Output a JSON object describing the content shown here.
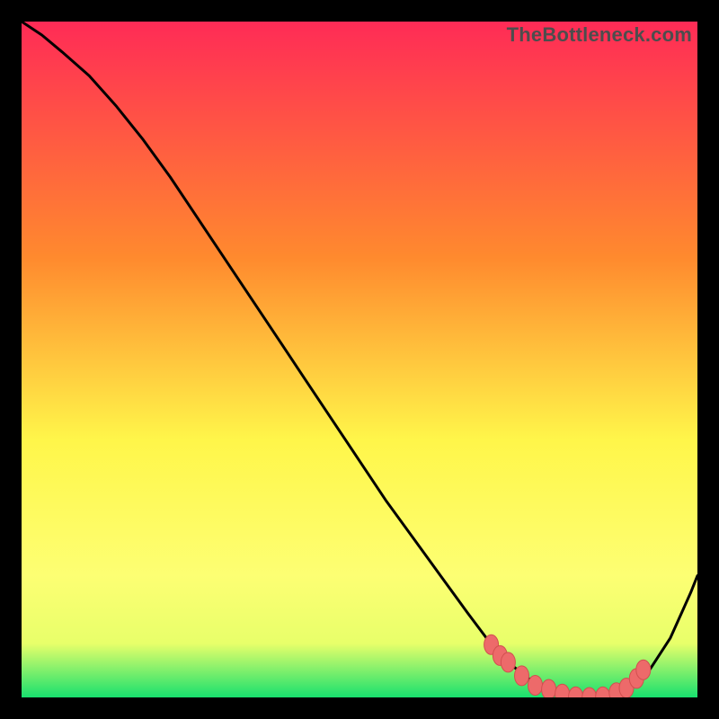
{
  "watermark": "TheBottleneck.com",
  "colors": {
    "frame": "#000000",
    "gradient_top": "#ff2b56",
    "gradient_upper_mid": "#ff8a2e",
    "gradient_mid": "#fff64a",
    "gradient_lower": "#e8ff6a",
    "gradient_bottom": "#18e06e",
    "curve": "#000000",
    "marker_fill": "#ed6a6a",
    "marker_stroke": "#d24f4f"
  },
  "chart_data": {
    "type": "line",
    "title": "",
    "xlabel": "",
    "ylabel": "",
    "xlim": [
      0,
      100
    ],
    "ylim": [
      0,
      100
    ],
    "grid": false,
    "series": [
      {
        "name": "bottleneck-curve",
        "x": [
          0,
          3,
          6,
          10,
          14,
          18,
          22,
          26,
          30,
          34,
          38,
          42,
          46,
          50,
          54,
          58,
          62,
          66,
          69,
          72,
          75,
          78,
          81,
          84,
          87,
          90,
          93,
          96,
          99,
          100
        ],
        "y": [
          100,
          98,
          95.5,
          92,
          87.5,
          82.5,
          77,
          71,
          65,
          59,
          53,
          47,
          41,
          35,
          29,
          23.5,
          18,
          12.5,
          8.5,
          5.2,
          2.8,
          1.2,
          0.3,
          0.0,
          0.2,
          1.5,
          4.2,
          8.8,
          15.5,
          18
        ]
      }
    ],
    "markers": {
      "name": "flat-bottom-markers",
      "points": [
        {
          "x": 69.5,
          "y": 7.8
        },
        {
          "x": 70.8,
          "y": 6.2
        },
        {
          "x": 72.0,
          "y": 5.2
        },
        {
          "x": 74.0,
          "y": 3.2
        },
        {
          "x": 76.0,
          "y": 1.8
        },
        {
          "x": 78.0,
          "y": 1.2
        },
        {
          "x": 80.0,
          "y": 0.5
        },
        {
          "x": 82.0,
          "y": 0.1
        },
        {
          "x": 84.0,
          "y": 0.0
        },
        {
          "x": 86.0,
          "y": 0.1
        },
        {
          "x": 88.0,
          "y": 0.7
        },
        {
          "x": 89.5,
          "y": 1.4
        },
        {
          "x": 91.0,
          "y": 2.8
        },
        {
          "x": 92.0,
          "y": 4.1
        }
      ]
    }
  }
}
